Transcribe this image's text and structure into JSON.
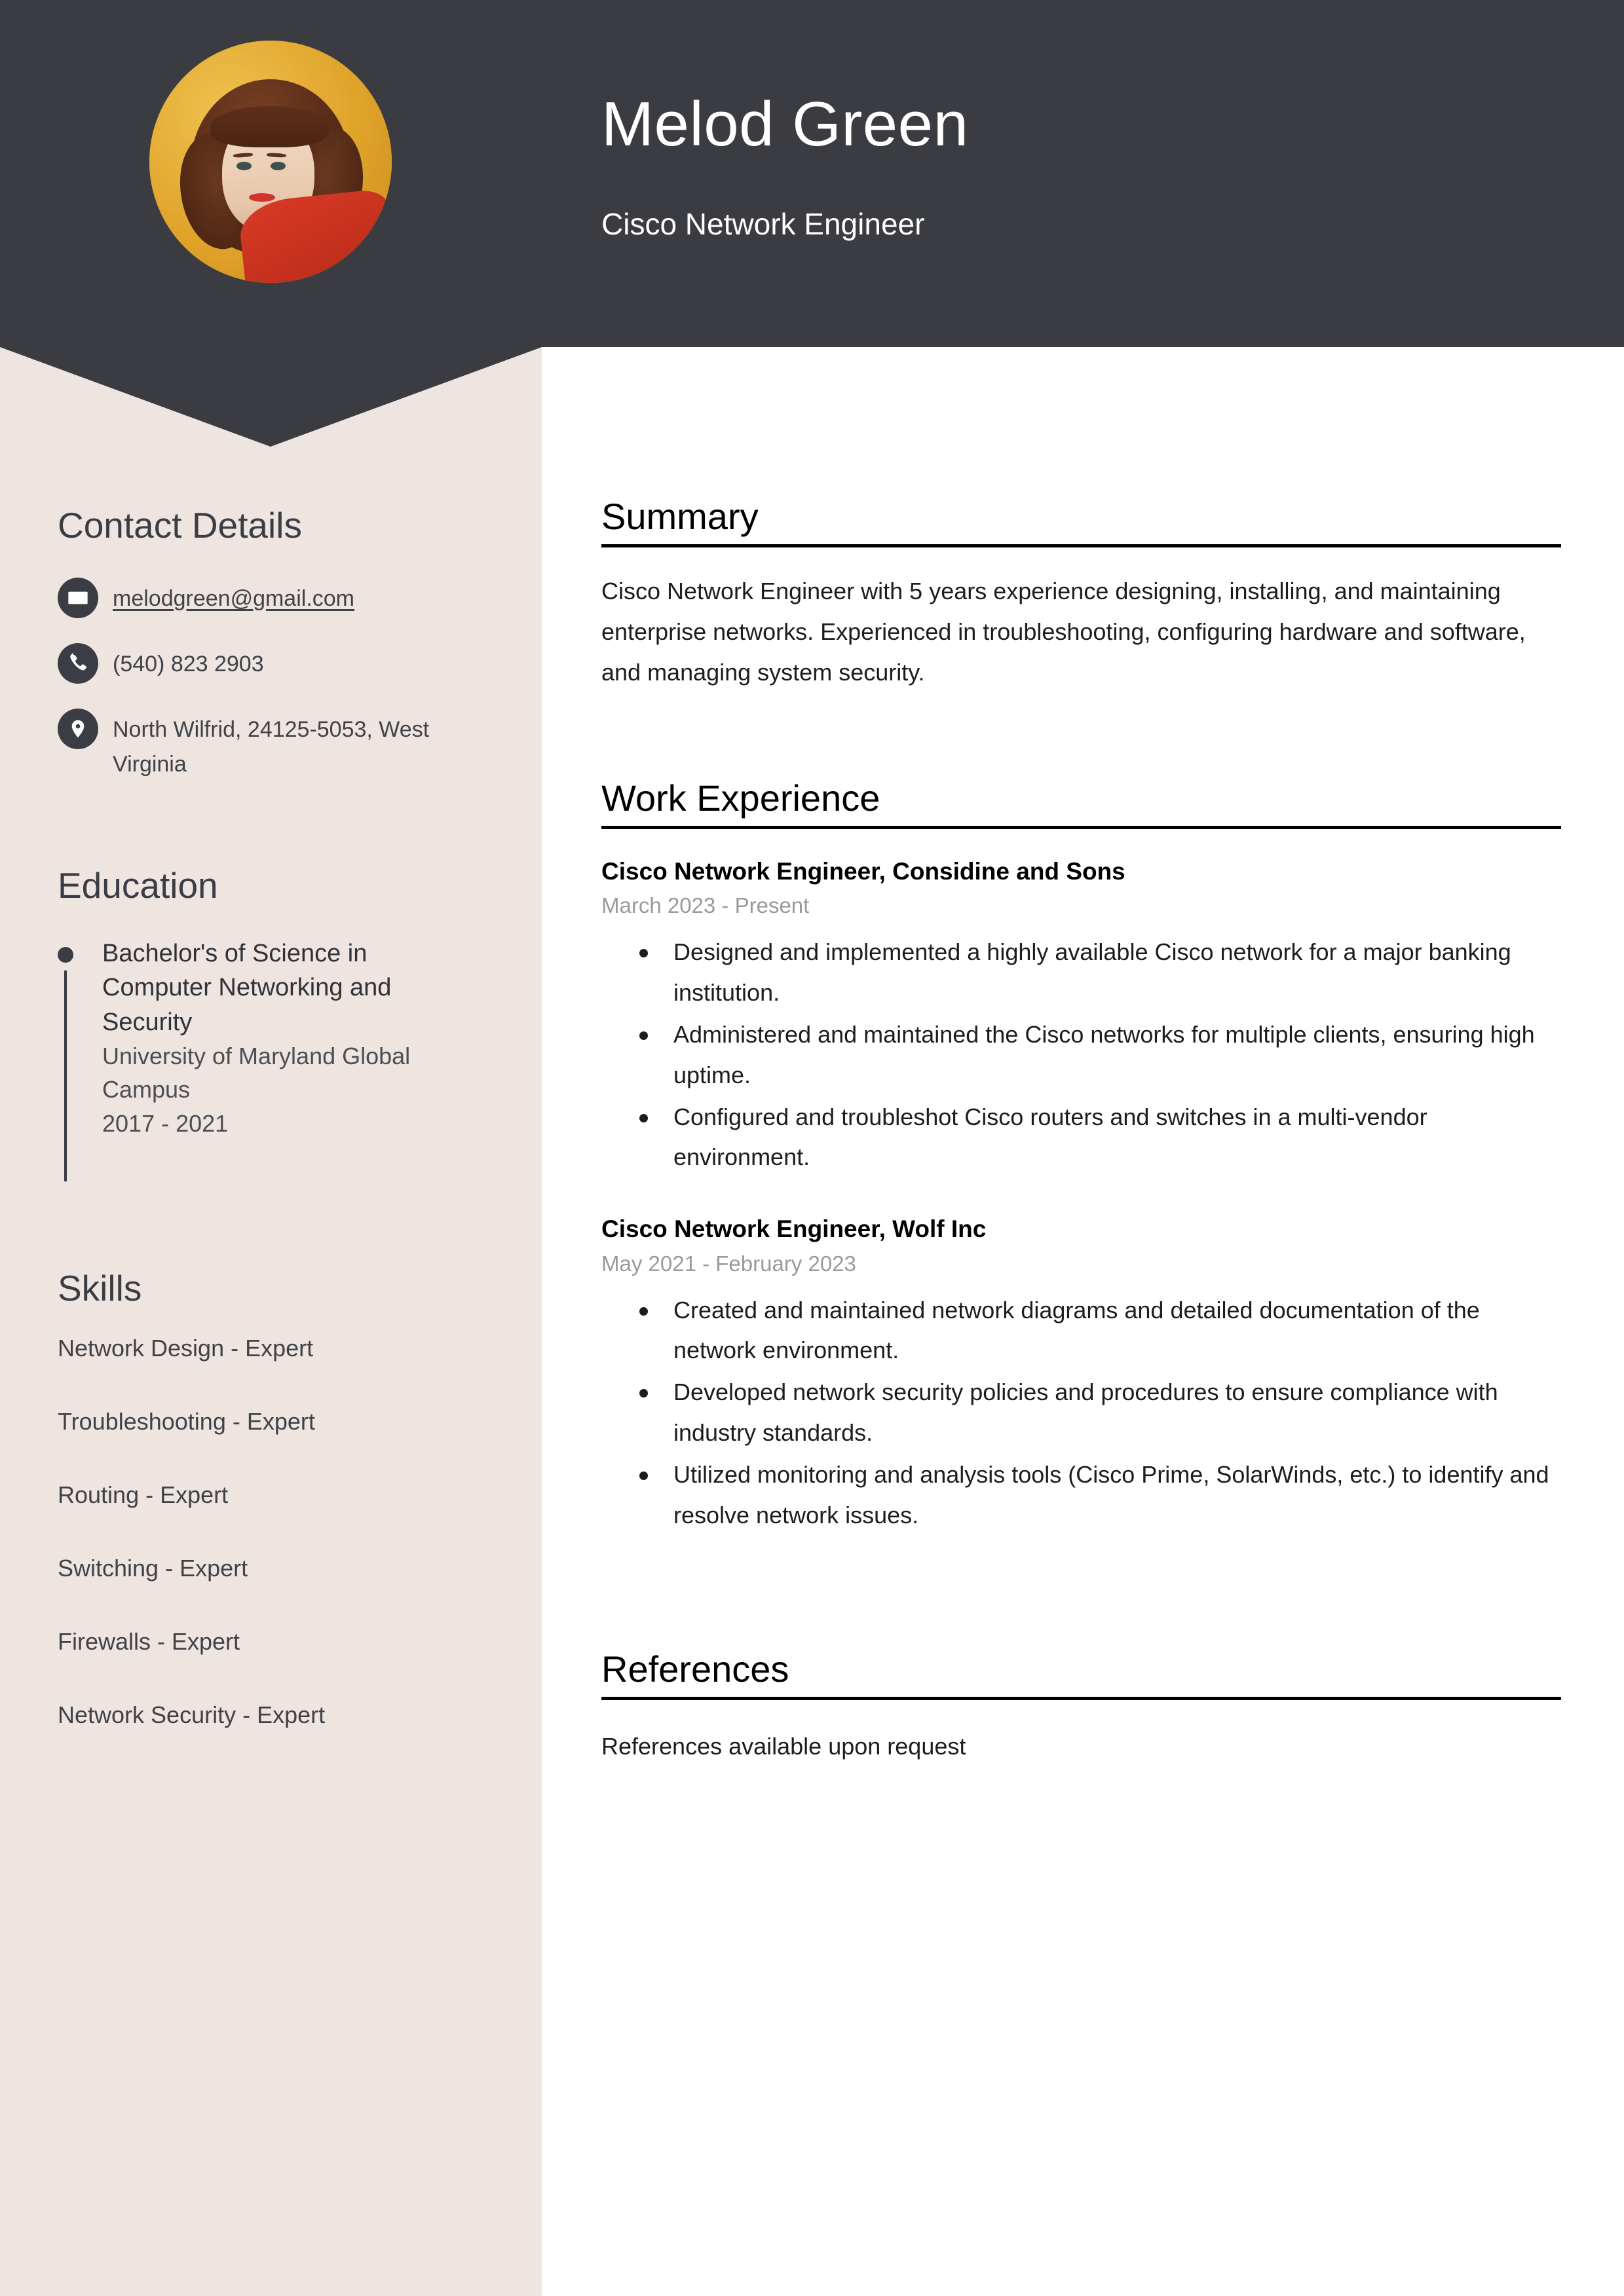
{
  "header": {
    "name": "Melod Green",
    "job_title": "Cisco Network Engineer",
    "background_color": "#3a3c42",
    "avatar_alt": "profile-photo"
  },
  "sidebar": {
    "background_color": "#eee5e0",
    "contact": {
      "heading": "Contact Details",
      "items": [
        {
          "icon": "envelope-icon",
          "value": "melodgreen@gmail.com",
          "is_link": true
        },
        {
          "icon": "phone-icon",
          "value": "(540) 823 2903",
          "is_link": false
        },
        {
          "icon": "location-pin-icon",
          "value": "North Wilfrid, 24125-5053, West Virginia",
          "is_link": false
        }
      ]
    },
    "education": {
      "heading": "Education",
      "entries": [
        {
          "degree": "Bachelor's of Science in Computer Networking and Security",
          "school": "University of Maryland Global Campus",
          "dates": "2017 - 2021"
        }
      ]
    },
    "skills": {
      "heading": "Skills",
      "items": [
        "Network Design - Expert",
        "Troubleshooting - Expert",
        "Routing - Expert",
        "Switching - Expert",
        "Firewalls - Expert",
        "Network Security - Expert"
      ]
    }
  },
  "main": {
    "summary": {
      "heading": "Summary",
      "text": "Cisco Network Engineer with 5 years experience designing, installing, and maintaining enterprise networks. Experienced in troubleshooting, configuring hardware and software, and managing system security."
    },
    "work_experience": {
      "heading": "Work Experience",
      "jobs": [
        {
          "role": "Cisco Network Engineer, Considine and Sons",
          "dates": "March 2023 - Present",
          "bullets": [
            "Designed and implemented a highly available Cisco network for a major banking institution.",
            "Administered and maintained the Cisco networks for multiple clients, ensuring high uptime.",
            "Configured and troubleshot Cisco routers and switches in a multi-vendor environment."
          ]
        },
        {
          "role": "Cisco Network Engineer, Wolf Inc",
          "dates": "May 2021 - February 2023",
          "bullets": [
            "Created and maintained network diagrams and detailed documentation of the network environment.",
            "Developed network security policies and procedures to ensure compliance with industry standards.",
            "Utilized monitoring and analysis tools (Cisco Prime, SolarWinds, etc.) to identify and resolve network issues."
          ]
        }
      ]
    },
    "references": {
      "heading": "References",
      "text": "References available upon request"
    }
  }
}
